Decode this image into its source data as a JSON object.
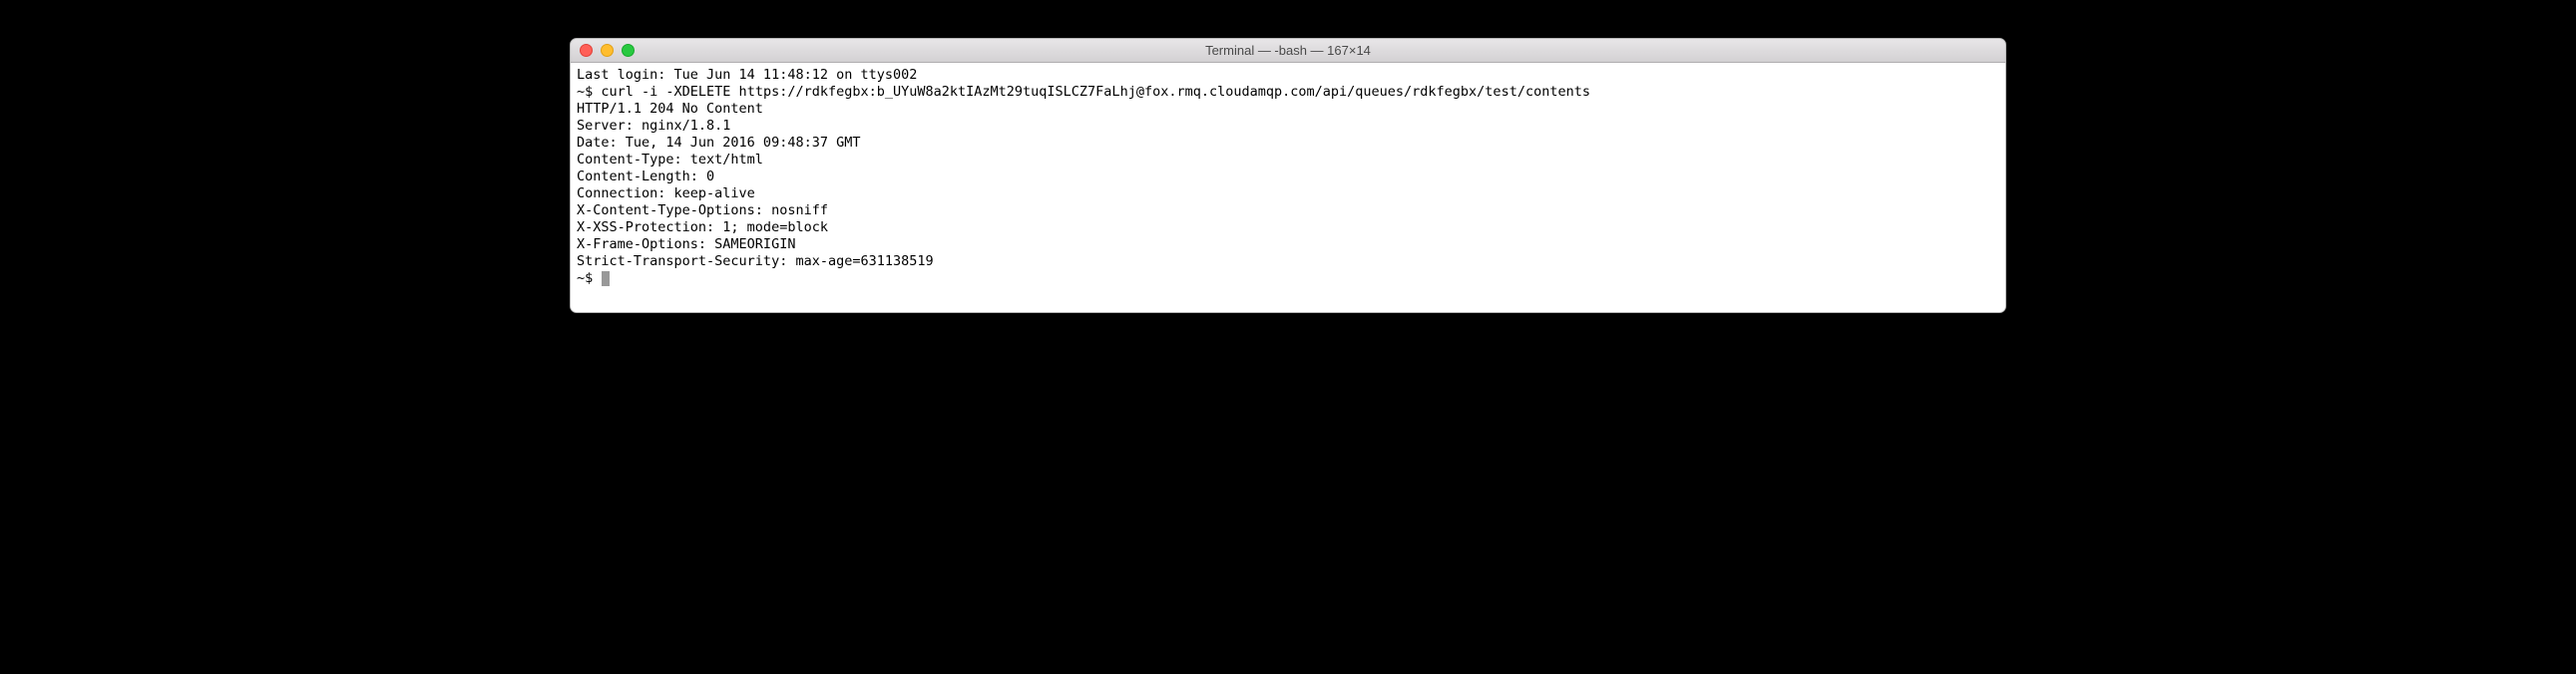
{
  "window": {
    "title": "Terminal — -bash — 167×14"
  },
  "session": {
    "last_login": "Last login: Tue Jun 14 11:48:12 on ttys002",
    "prompt1": "~$ ",
    "command": "curl -i -XDELETE https://rdkfegbx:b_UYuW8a2ktIAzMt29tuqISLCZ7FaLhj@fox.rmq.cloudamqp.com/api/queues/rdkfegbx/test/contents",
    "response": [
      "HTTP/1.1 204 No Content",
      "Server: nginx/1.8.1",
      "Date: Tue, 14 Jun 2016 09:48:37 GMT",
      "Content-Type: text/html",
      "Content-Length: 0",
      "Connection: keep-alive",
      "X-Content-Type-Options: nosniff",
      "X-XSS-Protection: 1; mode=block",
      "X-Frame-Options: SAMEORIGIN",
      "Strict-Transport-Security: max-age=631138519"
    ],
    "blank": "",
    "prompt2": "~$ "
  }
}
